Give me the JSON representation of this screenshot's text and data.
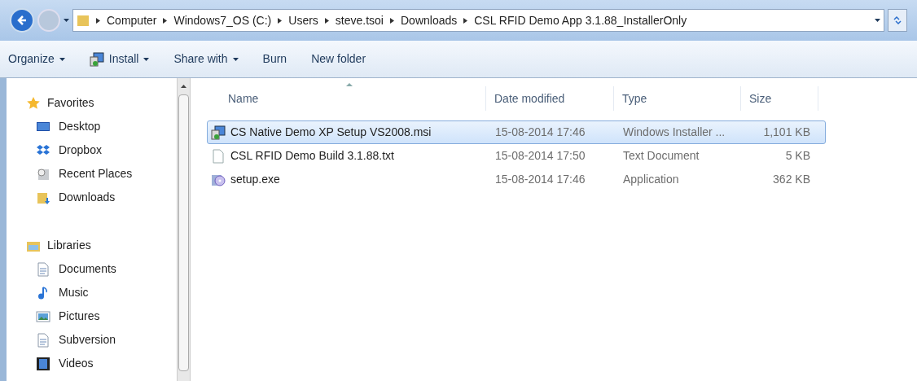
{
  "address_bar": {
    "path": [
      "Computer",
      "Windows7_OS (C:)",
      "Users",
      "steve.tsoi",
      "Downloads",
      "CSL RFID Demo App 3.1.88_InstallerOnly"
    ]
  },
  "toolbar": {
    "buttons": [
      {
        "label": "Organize",
        "dropdown": true,
        "kind": "plain"
      },
      {
        "label": "Install",
        "dropdown": true,
        "kind": "install"
      },
      {
        "label": "Share with",
        "dropdown": true,
        "kind": "plain"
      },
      {
        "label": "Burn",
        "dropdown": false,
        "kind": "plain"
      },
      {
        "label": "New folder",
        "dropdown": false,
        "kind": "plain"
      }
    ]
  },
  "sidebar": {
    "groups": [
      {
        "label": "Favorites",
        "kind": "star",
        "items": [
          {
            "label": "Desktop",
            "kind": "desktop"
          },
          {
            "label": "Dropbox",
            "kind": "dropbox"
          },
          {
            "label": "Recent Places",
            "kind": "recent"
          },
          {
            "label": "Downloads",
            "kind": "downloads"
          }
        ]
      },
      {
        "label": "Libraries",
        "kind": "library",
        "items": [
          {
            "label": "Documents",
            "kind": "document"
          },
          {
            "label": "Music",
            "kind": "music"
          },
          {
            "label": "Pictures",
            "kind": "pictures"
          },
          {
            "label": "Subversion",
            "kind": "document"
          },
          {
            "label": "Videos",
            "kind": "videos"
          }
        ]
      }
    ]
  },
  "table": {
    "columns": [
      {
        "label": "Name",
        "sorted": true
      },
      {
        "label": "Date modified",
        "sorted": false
      },
      {
        "label": "Type",
        "sorted": false
      },
      {
        "label": "Size",
        "sorted": false
      }
    ],
    "rows": [
      {
        "name": "CS Native Demo XP Setup VS2008.msi",
        "kind": "installer",
        "date": "15-08-2014 17:46",
        "type": "Windows Installer ...",
        "size": "1,101 KB",
        "selected": true
      },
      {
        "name": "CSL RFID Demo Build 3.1.88.txt",
        "kind": "text",
        "date": "15-08-2014 17:50",
        "type": "Text Document",
        "size": "5 KB",
        "selected": false
      },
      {
        "name": "setup.exe",
        "kind": "app",
        "date": "15-08-2014 17:46",
        "type": "Application",
        "size": "362 KB",
        "selected": false
      }
    ]
  }
}
